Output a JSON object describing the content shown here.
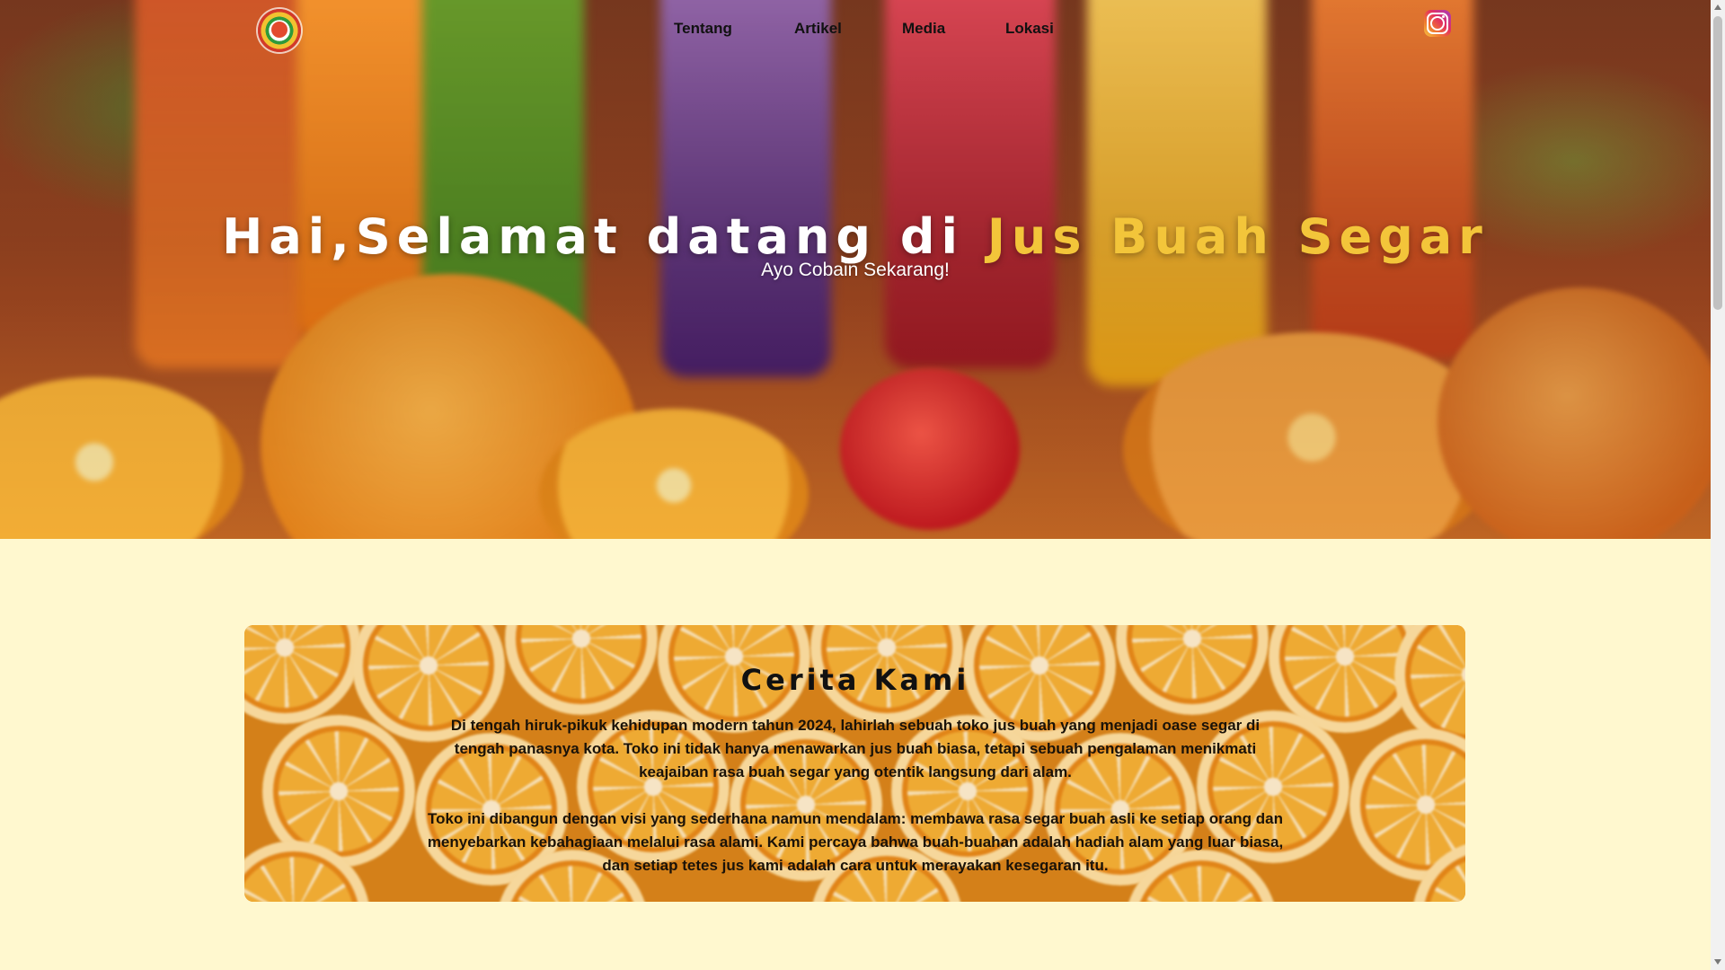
{
  "nav": {
    "logo_name": "jus-buah-segar-logo",
    "links": [
      "Tentang",
      "Artikel",
      "Media",
      "Lokasi"
    ],
    "social_icon": "instagram-icon"
  },
  "hero": {
    "title_prefix": "Hai,Selamat datang di ",
    "title_highlight": "Jus Buah Segar",
    "subtitle": "Ayo Cobain Sekarang!",
    "highlight_color": "#f3c53a"
  },
  "story": {
    "title": "Cerita Kami",
    "paragraphs": [
      "Di tengah hiruk-pikuk kehidupan modern tahun 2024, lahirlah sebuah toko jus buah yang menjadi oase segar di tengah panasnya kota. Toko ini tidak hanya menawarkan jus buah biasa, tetapi sebuah pengalaman menikmati keajaiban rasa buah segar yang otentik langsung dari alam.",
      "Toko ini dibangun dengan visi yang sederhana namun mendalam: membawa rasa segar buah asli ke setiap orang dan menyebarkan kebahagiaan melalui rasa alami. Kami percaya bahwa buah-buahan adalah hadiah alam yang luar biasa, dan setiap tetes jus kami adalah cara untuk merayakan kesegaran itu."
    ]
  },
  "colors": {
    "page_background": "#fff8cf",
    "nav_text": "#111111",
    "hero_text": "#ffffff"
  }
}
